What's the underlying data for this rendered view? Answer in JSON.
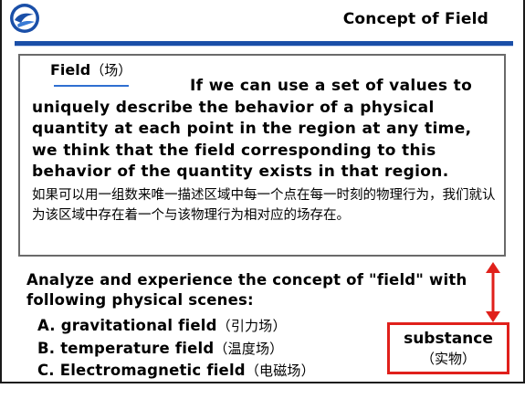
{
  "slide": {
    "title": "Concept of  Field"
  },
  "definition": {
    "term": "Field",
    "term_zh": "（场）",
    "text_en": "If we can use a set of values to uniquely describe the behavior of a physical quantity at each point in the region at any time, we think that the field corresponding to this behavior of the quantity exists in that region.",
    "text_zh": "如果可以用一组数来唯一描述区域中每一个点在每一时刻的物理行为，我们就认为该区域中存在着一个与该物理行为相对应的场存在。"
  },
  "analyze": {
    "text": "Analyze and experience the concept of \"field\" with following physical scenes:"
  },
  "scenes": [
    {
      "label": "A. gravitational field",
      "zh": "（引力场）"
    },
    {
      "label": "B. temperature field",
      "zh": "（温度场）"
    },
    {
      "label": "C. Electromagnetic field",
      "zh": "（电磁场）"
    }
  ],
  "substance": {
    "label": "substance",
    "zh": "（实物）"
  },
  "colors": {
    "rule": "#1a4fa8",
    "accent_red": "#e0201b",
    "term_underline": "#2f6fd1"
  }
}
